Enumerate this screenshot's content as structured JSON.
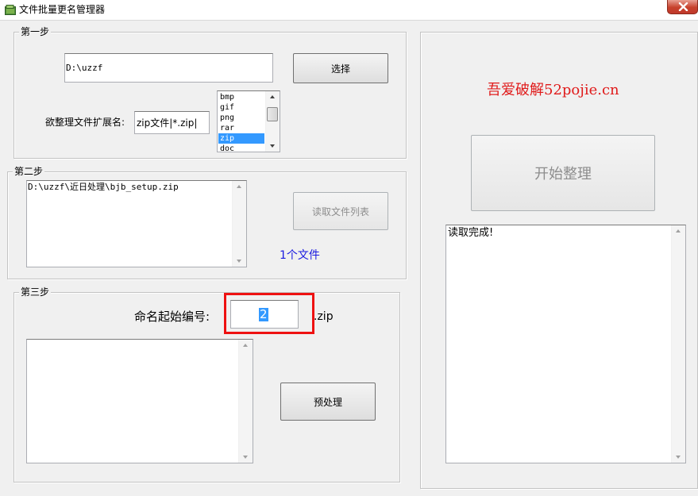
{
  "window": {
    "title": "文件批量更名管理器",
    "icon": "folder-app-icon",
    "close_icon": "close-icon"
  },
  "step1": {
    "legend": "第一步",
    "path_value": "D:\\uzzf",
    "select_button": "选择",
    "ext_label": "欲整理文件扩展名:",
    "ext_value": "zip文件|*.zip|",
    "ext_list": [
      "bmp",
      "gif",
      "png",
      "rar",
      "zip",
      "doc"
    ],
    "ext_selected": "zip"
  },
  "step2": {
    "legend": "第二步",
    "file_list": [
      "D:\\uzzf\\近日处理\\bjb_setup.zip"
    ],
    "read_button": "读取文件列表",
    "file_count": "1个文件"
  },
  "step3": {
    "legend": "第三步",
    "start_label": "命名起始编号:",
    "start_value": "2",
    "ext_suffix": ".zip",
    "preprocess_button": "预处理"
  },
  "right": {
    "watermark": "吾爱破解52pojie.cn",
    "start_button": "开始整理",
    "log_text": "读取完成!"
  },
  "colors": {
    "watermark": "#e01b1b",
    "file_count": "#1a1ae0",
    "highlight_box": "#ee1111",
    "selection": "#3399ff"
  }
}
